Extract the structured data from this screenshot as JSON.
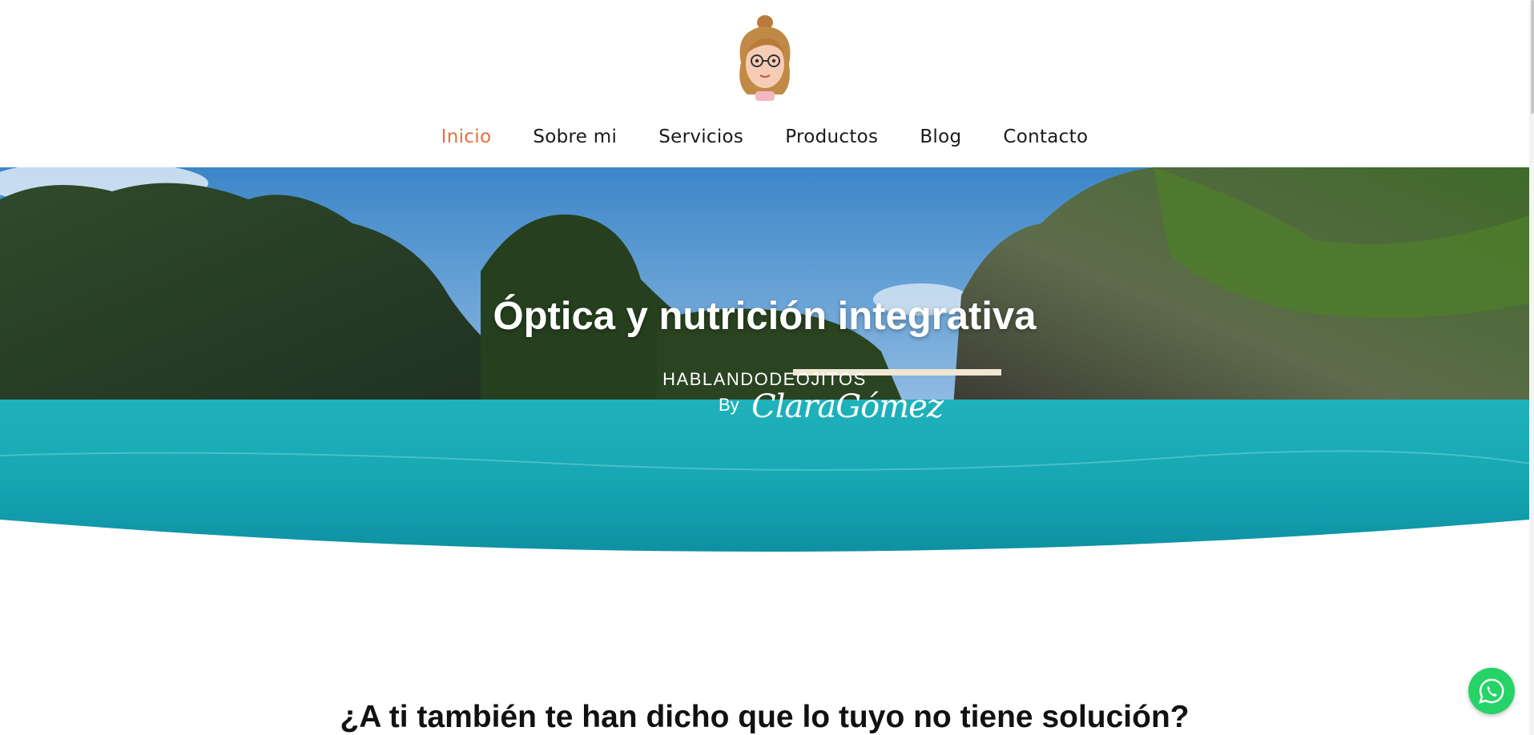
{
  "header": {
    "logo_icon": "avatar-icon",
    "nav": [
      {
        "label": "Inicio",
        "active": true
      },
      {
        "label": "Sobre mi",
        "active": false
      },
      {
        "label": "Servicios",
        "active": false
      },
      {
        "label": "Productos",
        "active": false
      },
      {
        "label": "Blog",
        "active": false
      },
      {
        "label": "Contacto",
        "active": false
      }
    ]
  },
  "hero": {
    "title": "Óptica y nutrición integrativa",
    "brand": "HABLANDODEOJITOS",
    "by": "By",
    "signature": "ClaraGómez"
  },
  "section": {
    "heading": "¿A ti también te han dicho que lo tuyo no tiene solución?"
  },
  "floating": {
    "whatsapp_icon": "whatsapp-icon"
  },
  "colors": {
    "accent": "#e2703e",
    "whatsapp": "#25d366"
  }
}
